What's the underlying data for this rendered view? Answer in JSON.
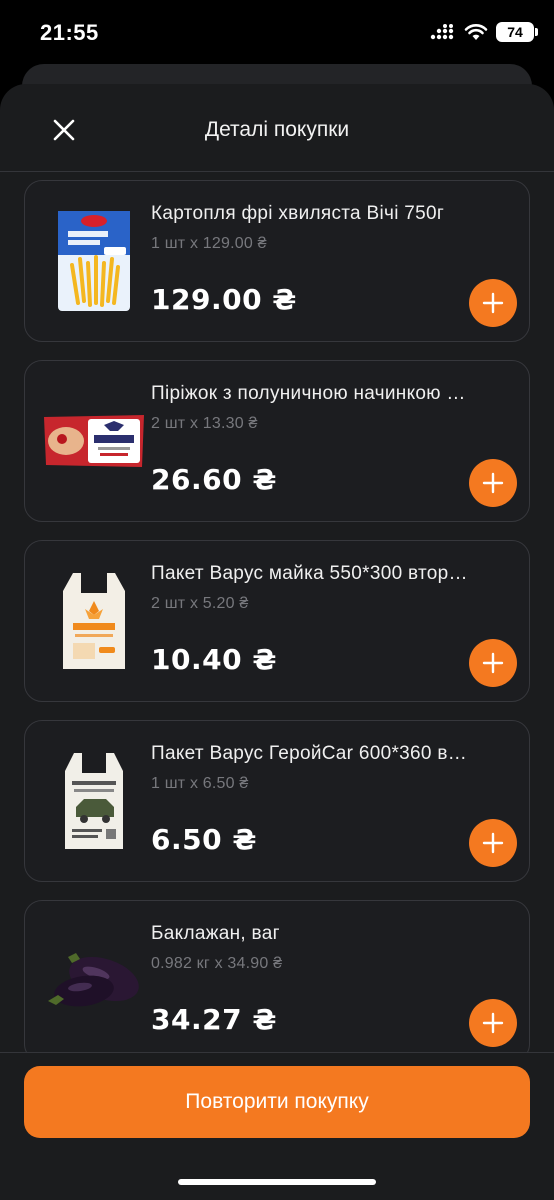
{
  "status_bar": {
    "time": "21:55",
    "battery": "74"
  },
  "header": {
    "title": "Деталі покупки"
  },
  "items": [
    {
      "name": "Картопля фрі хвиляста Вічі 750г",
      "qty": "1 шт x 129.00 ₴",
      "price": "129.00 ₴",
      "image": "fries-package"
    },
    {
      "name": "Піріжок з полуничною начинкою …",
      "qty": "2 шт x 13.30 ₴",
      "price": "26.60 ₴",
      "image": "pie-package"
    },
    {
      "name": "Пакет Варус майка 550*300 втор…",
      "qty": "2 шт x 5.20 ₴",
      "price": "10.40 ₴",
      "image": "varus-bag"
    },
    {
      "name": "Пакет Варус ГеройCar 600*360 в…",
      "qty": "1 шт x 6.50 ₴",
      "price": "6.50 ₴",
      "image": "herocar-bag"
    },
    {
      "name": "Баклажан, ваг",
      "qty": "0.982 кг x 34.90 ₴",
      "price": "34.27 ₴",
      "image": "eggplant"
    }
  ],
  "footer": {
    "repeat_label": "Повторити покупку"
  },
  "colors": {
    "accent": "#f47920",
    "background": "#1b1c1e",
    "card_border": "#36373c"
  }
}
